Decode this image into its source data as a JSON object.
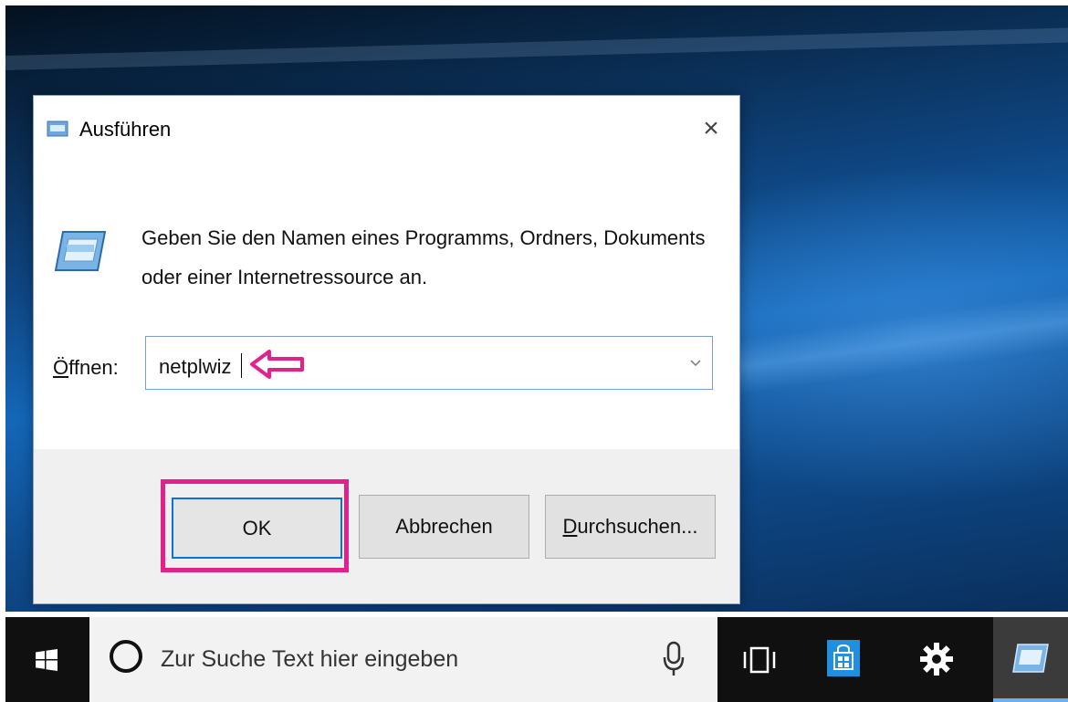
{
  "dialog": {
    "title": "Ausführen",
    "close_symbol": "×",
    "description": "Geben Sie den Namen eines Programms, Ordners, Dokuments oder einer Internetressource an.",
    "open_label_accel": "Ö",
    "open_label_rest": "ffnen:",
    "open_value": "netplwiz",
    "buttons": {
      "ok": "OK",
      "cancel": "Abbrechen",
      "browse_accel": "D",
      "browse_rest": "urchsuchen..."
    }
  },
  "taskbar": {
    "search_placeholder": "Zur Suche Text hier eingeben"
  },
  "icons": {
    "title": "run-icon",
    "large": "run-icon",
    "annotation": "arrow-left-icon",
    "dropdown": "chevron-down-icon",
    "start": "windows-logo-icon",
    "cortana": "cortana-circle-icon",
    "mic": "microphone-icon",
    "taskview": "task-view-icon",
    "store": "store-icon",
    "settings": "gear-icon",
    "run_task": "run-icon"
  },
  "colors": {
    "highlight": "#e0228a",
    "ok_focus": "#0a74d6",
    "taskbar": "#101010",
    "store": "#1f8fe0"
  }
}
